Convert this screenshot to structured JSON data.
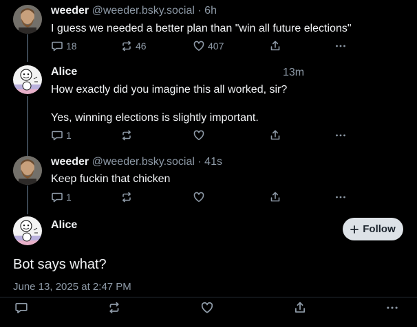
{
  "colors": {
    "background": "#000000",
    "text_primary": "#f1f3f5",
    "text_secondary": "#8d99a6",
    "thread_line": "#3b4652",
    "follow_button_bg": "#dde2e7"
  },
  "posts": [
    {
      "display_name": "weeder",
      "handle": "@weeder.bsky.social",
      "time_sep": "·",
      "time": "6h",
      "text": "I guess we needed a better plan than \"win all future elections\"",
      "replies": "18",
      "reposts": "46",
      "likes": "407"
    },
    {
      "display_name": "Alice",
      "time": "13m",
      "text_line1": "How exactly did you imagine this all worked, sir?",
      "text_line2": "Yes, winning elections is slightly important.",
      "replies": "1"
    },
    {
      "display_name": "weeder",
      "handle": "@weeder.bsky.social",
      "time_sep": "·",
      "time": "41s",
      "text": "Keep fuckin that chicken",
      "replies": "1"
    }
  ],
  "focused_post": {
    "display_name": "Alice",
    "follow_label": "Follow",
    "text": "Bot says what?",
    "timestamp": "June 13, 2025 at 2:47 PM"
  },
  "icons": {
    "reply": "reply-icon",
    "repost": "repost-icon",
    "like": "heart-icon",
    "share": "share-icon",
    "more": "more-icon",
    "plus": "plus-icon"
  }
}
